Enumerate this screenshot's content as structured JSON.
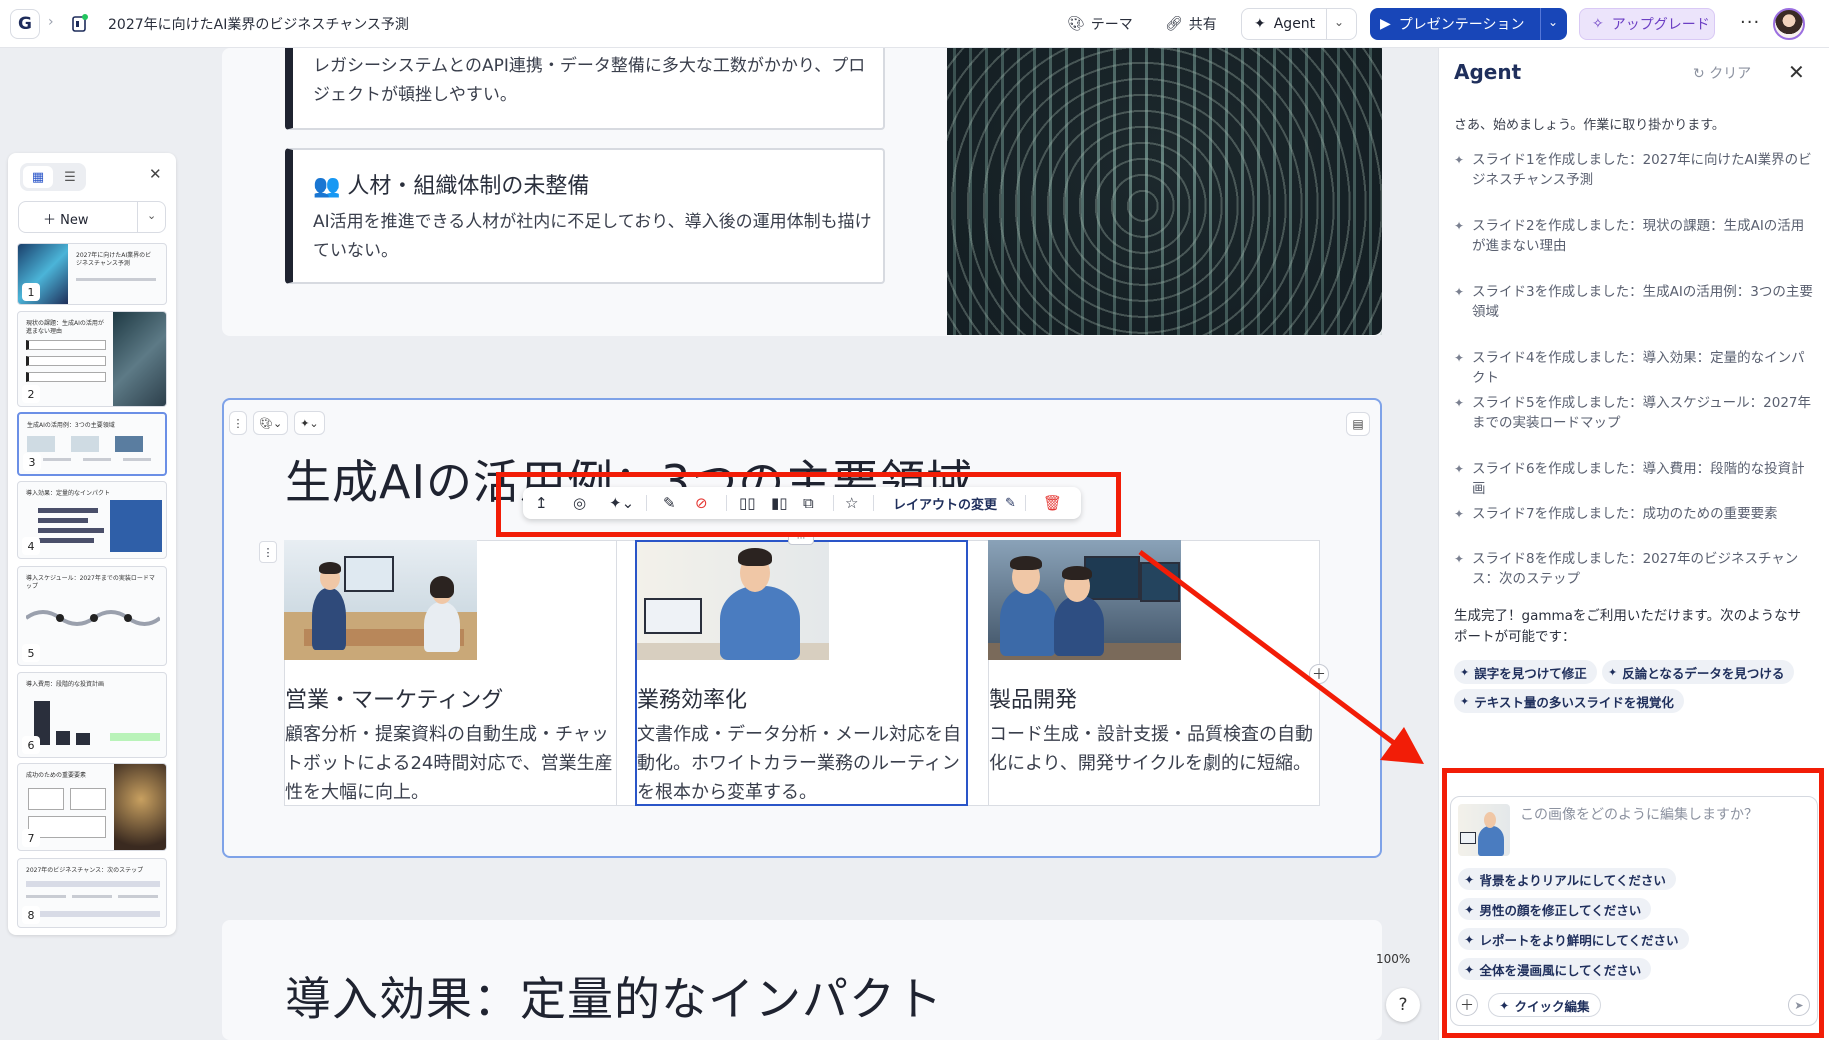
{
  "app": {
    "doc_title": "2027年に向けたAI業界のビジネスチャンス予測",
    "theme_label": "テーマ",
    "share_label": "共有",
    "agent_label": "Agent",
    "present_label": "プレゼンテーション",
    "upgrade_label": "アップグレード",
    "accent_color": "#1846b8"
  },
  "thumbnails": {
    "new_label": "New",
    "items": [
      {
        "num": "1",
        "title": "2027年に向けたAI業界のビジネスチャンス予測"
      },
      {
        "num": "2",
        "title": "現状の課題：生成AIの活用が進まない理由"
      },
      {
        "num": "3",
        "title": "生成AIの活用例：3つの主要領域"
      },
      {
        "num": "4",
        "title": "導入効果：定量的なインパクト"
      },
      {
        "num": "5",
        "title": "導入スケジュール：2027年までの実装ロードマップ"
      },
      {
        "num": "6",
        "title": "導入費用：段階的な投資計画"
      },
      {
        "num": "7",
        "title": "成功のための重要要素"
      },
      {
        "num": "8",
        "title": "2027年のビジネスチャンス：次のステップ"
      }
    ]
  },
  "slide_prev": {
    "callout1_body": "レガシーシステムとのAPI連携・データ整備に多大な工数がかかり、プロジェクトが頓挫しやすい。",
    "callout2_title": "👥 人材・組織体制の未整備",
    "callout2_body": "AI活用を推進できる人材が社内に不足しており、導入後の運用体制も描けていない。"
  },
  "slide_current": {
    "title": "生成AIの活用例：3つの主要領域",
    "toolbar_layout_label": "レイアウトの変更",
    "cards": [
      {
        "head": "営業・マーケティング",
        "body": "顧客分析・提案資料の自動生成・チャットボットによる24時間対応で、営業生産性を大幅に向上。"
      },
      {
        "head": "業務効率化",
        "body": "文書作成・データ分析・メール対応を自動化。ホワイトカラー業務のルーティンを根本から変革する。"
      },
      {
        "head": "製品開発",
        "body": "コード生成・設計支援・品質検査の自動化により、開発サイクルを劇的に短縮。"
      }
    ]
  },
  "slide_next": {
    "title": "導入効果：定量的なインパクト"
  },
  "zoom": "100%",
  "help": "?",
  "agent": {
    "title": "Agent",
    "clear_label": "クリア",
    "intro": "さあ、始めましょう。作業に取り掛かります。",
    "log": [
      "スライド1を作成しました：2027年に向けたAI業界のビジネスチャンス予測",
      "スライド2を作成しました：現状の課題：生成AIの活用が進まない理由",
      "スライド3を作成しました：生成AIの活用例：3つの主要領域",
      "スライド4を作成しました：導入効果：定量的なインパクト",
      "スライド5を作成しました：導入スケジュール：2027年までの実装ロードマップ",
      "スライド6を作成しました：導入費用：段階的な投資計画",
      "スライド7を作成しました：成功のための重要要素",
      "スライド8を作成しました：2027年のビジネスチャンス：次のステップ"
    ],
    "done": "生成完了！gammaをご利用いただけます。次のようなサポートが可能です：",
    "chips": [
      "誤字を見つけて修正",
      "反論となるデータを見つける",
      "テキスト量の多いスライドを視覚化"
    ],
    "composer_placeholder": "この画像をどのように編集しますか？",
    "suggestions": [
      "背景をよりリアルにしてください",
      "男性の顔を修正してください",
      "レポートをより鮮明にしてください",
      "全体を漫画風にしてください"
    ],
    "quick_edit_label": "クイック編集"
  },
  "annotation_color": "#f21d07"
}
